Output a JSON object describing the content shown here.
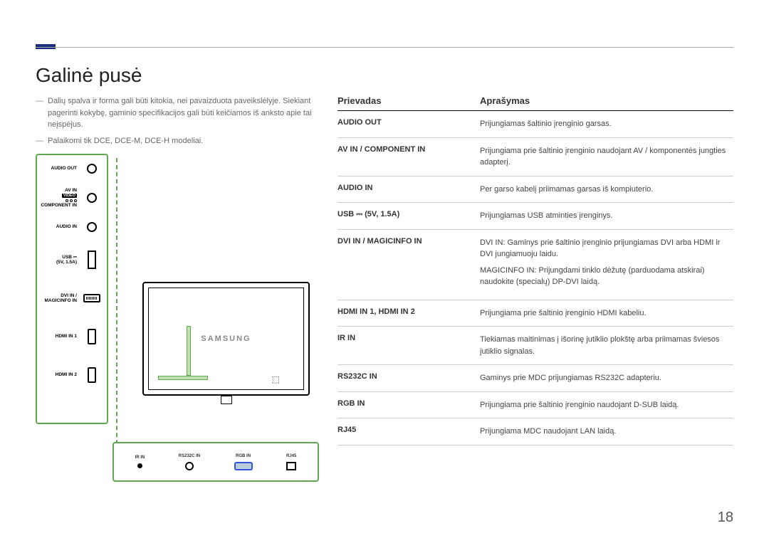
{
  "page": {
    "title": "Galinė pusė",
    "number": "18"
  },
  "notes": {
    "n1": "Dalių spalva ir forma gali būti kitokia, nei pavaizduota paveikslėlyje. Siekiant pagerinti kokybę, gaminio specifikacijos gali būti keičiamos iš anksto apie tai neįspėjus.",
    "n2": "Palaikomi tik DCE, DCE-M, DCE-H modeliai."
  },
  "table": {
    "head_port": "Prievadas",
    "head_desc": "Aprašymas",
    "rows": [
      {
        "port": "AUDIO OUT",
        "desc": "Prijungiamas šaltinio įrenginio garsas."
      },
      {
        "port": "AV IN / COMPONENT IN",
        "desc": "Prijungiama prie šaltinio įrenginio naudojant AV / komponentės jungties adapterį."
      },
      {
        "port": "AUDIO IN",
        "desc": "Per garso kabelį priimamas garsas iš kompiuterio."
      },
      {
        "port": "USB ⎓ (5V, 1.5A)",
        "desc": "Prijungiamas USB atminties įrenginys."
      },
      {
        "port": "DVI IN / MAGICINFO IN",
        "desc": "DVI IN: Gaminys prie šaltinio įrenginio prijungiamas DVI arba HDMI ir DVI jungiamuoju laidu.",
        "desc2": "MAGICINFO IN: Prijungdami tinklo dėžutę (parduodama atskirai) naudokite (specialų) DP-DVI laidą."
      },
      {
        "port": "HDMI IN 1, HDMI IN 2",
        "desc": "Prijungiama prie šaltinio įrenginio HDMI kabeliu."
      },
      {
        "port": "IR IN",
        "desc": "Tiekiamas maitinimas į išorinę jutiklio plokštę arba priimamas šviesos jutiklio signalas."
      },
      {
        "port": "RS232C IN",
        "desc": "Gaminys prie MDC prijungiamas RS232C adapteriu."
      },
      {
        "port": "RGB IN",
        "desc": "Prijungiama prie šaltinio įrenginio naudojant D-SUB laidą."
      },
      {
        "port": "RJ45",
        "desc": "Prijungiama MDC naudojant LAN laidą."
      }
    ]
  },
  "side_ports": {
    "p1": "AUDIO OUT",
    "p2a": "AV IN",
    "p2b": "VIDEO",
    "p2c": "COMPONENT IN",
    "p3": "AUDIO IN",
    "p4a": "USB ⎓",
    "p4b": "(5V, 1.5A)",
    "p5a": "DVI IN /",
    "p5b": "MAGICINFO IN",
    "p6": "HDMI IN 1",
    "p7": "HDMI IN 2"
  },
  "bottom_ports": {
    "b1": "IR IN",
    "b2": "RS232C IN",
    "b3": "RGB IN",
    "b4": "RJ45"
  },
  "monitor": {
    "logo": "SAMSUNG"
  }
}
